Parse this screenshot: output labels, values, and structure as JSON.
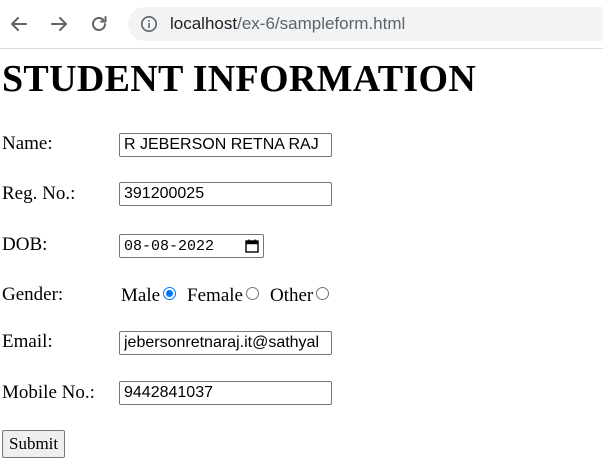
{
  "browser": {
    "url_host": "localhost",
    "url_path": "/ex-6/sampleform.html"
  },
  "form": {
    "title": "STUDENT INFORMATION",
    "name_label": "Name:",
    "name_value": "R JEBERSON RETNA RAJ",
    "regno_label": "Reg. No.:",
    "regno_value": "391200025",
    "dob_label": "DOB:",
    "dob_value": "08-08-2022",
    "gender_label": "Gender:",
    "gender_options": [
      {
        "label": "Male",
        "checked": true
      },
      {
        "label": "Female",
        "checked": false
      },
      {
        "label": "Other",
        "checked": false
      }
    ],
    "email_label": "Email:",
    "email_value": "jebersonretnaraj.it@sathyal",
    "mobile_label": "Mobile No.:",
    "mobile_value": "9442841037",
    "submit_label": "Submit"
  },
  "colors": {
    "accent": "#0075ff",
    "omnibox_bg": "#f1f3f4"
  },
  "icons": [
    "back-arrow-icon",
    "forward-arrow-icon",
    "reload-icon",
    "site-info-icon",
    "calendar-icon"
  ]
}
